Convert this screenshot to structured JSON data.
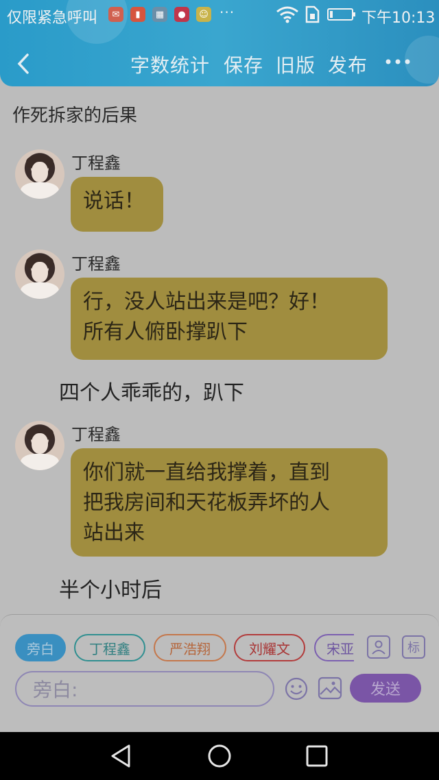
{
  "status_bar": {
    "carrier_text": "仅限紧急呼叫",
    "notification_icons": [
      "mail-icon",
      "bottle-icon",
      "gallery-icon",
      "app-red-icon",
      "app-smile-icon"
    ],
    "more": "···",
    "time": "下午10:13"
  },
  "toolbar": {
    "word_count": "字数统计",
    "save": "保存",
    "old_version": "旧版",
    "publish": "发布"
  },
  "chapter_title": "作死拆家的后果",
  "messages": [
    {
      "speaker": "丁程鑫",
      "lines": [
        "说话！"
      ]
    },
    {
      "speaker": "丁程鑫",
      "lines": [
        "行，没人站出来是吧？好！",
        "所有人俯卧撑趴下"
      ]
    },
    {
      "narration": "四个人乖乖的，趴下"
    },
    {
      "speaker": "丁程鑫",
      "lines": [
        "你们就一直给我撑着，直到",
        "把我房间和天花板弄坏的人",
        "站出来"
      ]
    },
    {
      "narration": "半个小时后"
    }
  ],
  "compose": {
    "roles": [
      "旁白",
      "丁程鑫",
      "严浩翔",
      "刘耀文",
      "宋亚轩"
    ],
    "role_colors": [
      "#3a8fc0",
      "#2f8f90",
      "#c4764a",
      "#b23b3b",
      "#7b5fb0"
    ],
    "tag_icon_label": "标",
    "input_placeholder": "旁白:",
    "send_label": "发送"
  }
}
